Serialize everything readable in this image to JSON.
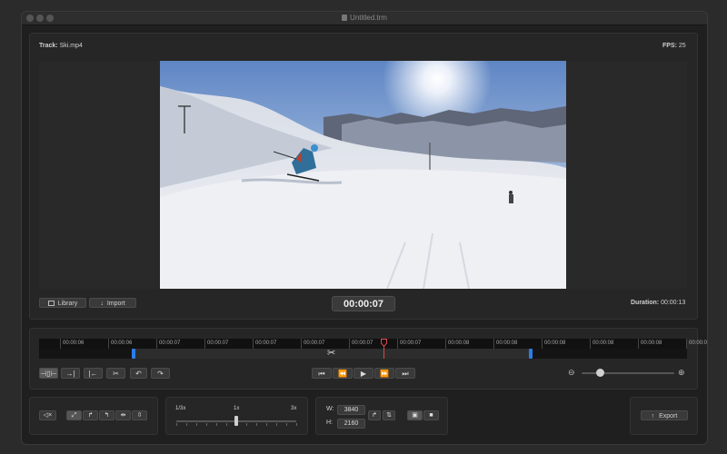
{
  "window": {
    "title": "Untitled.trm"
  },
  "header": {
    "track_label": "Track:",
    "track_value": "Ski.mp4",
    "fps_label": "FPS:",
    "fps_value": "25"
  },
  "preview": {
    "library_label": "Library",
    "import_label": "Import",
    "current_time": "00:00:07",
    "duration_label": "Duration:",
    "duration_value": "00:00:13"
  },
  "timeline": {
    "ticks": [
      "00:00:06",
      "00:00:06",
      "00:00:07",
      "00:00:07",
      "00:00:07",
      "00:00:07",
      "00:00:07",
      "00:00:07",
      "00:00:08",
      "00:00:08",
      "00:00:08",
      "00:00:08",
      "00:00:08",
      "00:00:0"
    ],
    "zoom_level": 0.2
  },
  "speed": {
    "min_label": "1/3x",
    "mid_label": "1x",
    "max_label": "3x",
    "value": 1
  },
  "size": {
    "w_label": "W:",
    "w_value": "3840",
    "h_label": "H:",
    "h_value": "2160"
  },
  "export": {
    "label": "Export"
  },
  "colors": {
    "accent": "#2b7de9",
    "playhead": "#e04848"
  }
}
